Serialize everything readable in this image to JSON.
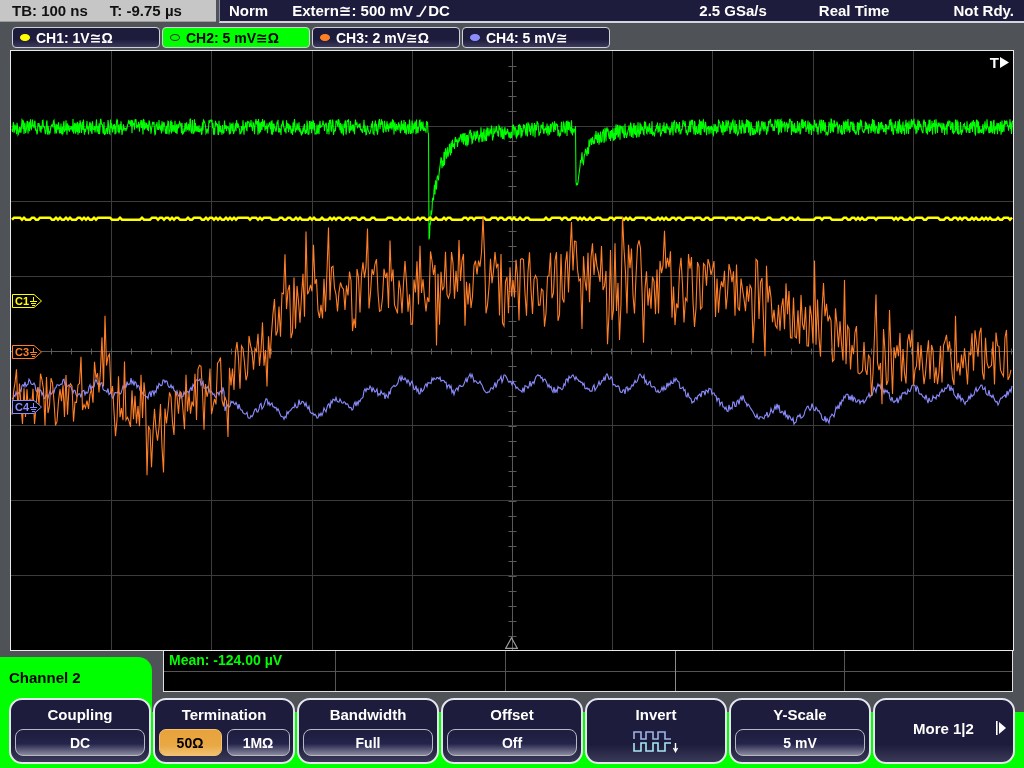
{
  "status_bar": {
    "timebase": "TB: 100 ns",
    "trigger_time": "T: -9.75 µs",
    "trigger_mode": "Norm",
    "trigger_source": "Extern≅: 500 mV",
    "trigger_coupling": "DC",
    "sample_rate": "2.5 GSa/s",
    "acquisition_mode": "Real Time",
    "status": "Not Rdy."
  },
  "channels": [
    {
      "label": "CH1: 1V≅Ω",
      "color": "#ffff00",
      "selected": false,
      "marker": "C1"
    },
    {
      "label": "CH2: 5 mV≅Ω",
      "color": "#00ff00",
      "selected": true
    },
    {
      "label": "CH3: 2 mV≅Ω",
      "color": "#ff7f27",
      "selected": false,
      "marker": "C3"
    },
    {
      "label": "CH4: 5 mV≅",
      "color": "#8c8cff",
      "selected": false,
      "marker": "C4"
    }
  ],
  "display": {
    "trigger_label": "T"
  },
  "measurement": {
    "text": "Mean: -124.00 µV"
  },
  "menu": {
    "title": "Channel 2",
    "softkeys": [
      {
        "kind": "value",
        "label": "Coupling",
        "value": "DC"
      },
      {
        "kind": "toggle",
        "label": "Termination",
        "options": [
          {
            "label": "50Ω",
            "selected": true
          },
          {
            "label": "1MΩ",
            "selected": false
          }
        ]
      },
      {
        "kind": "value",
        "label": "Bandwidth",
        "value": "Full"
      },
      {
        "kind": "value",
        "label": "Offset",
        "value": "Off"
      },
      {
        "kind": "icon",
        "label": "Invert"
      },
      {
        "kind": "value",
        "label": "Y-Scale",
        "value": "5 mV"
      },
      {
        "kind": "more",
        "label": "More 1|2"
      }
    ]
  }
}
